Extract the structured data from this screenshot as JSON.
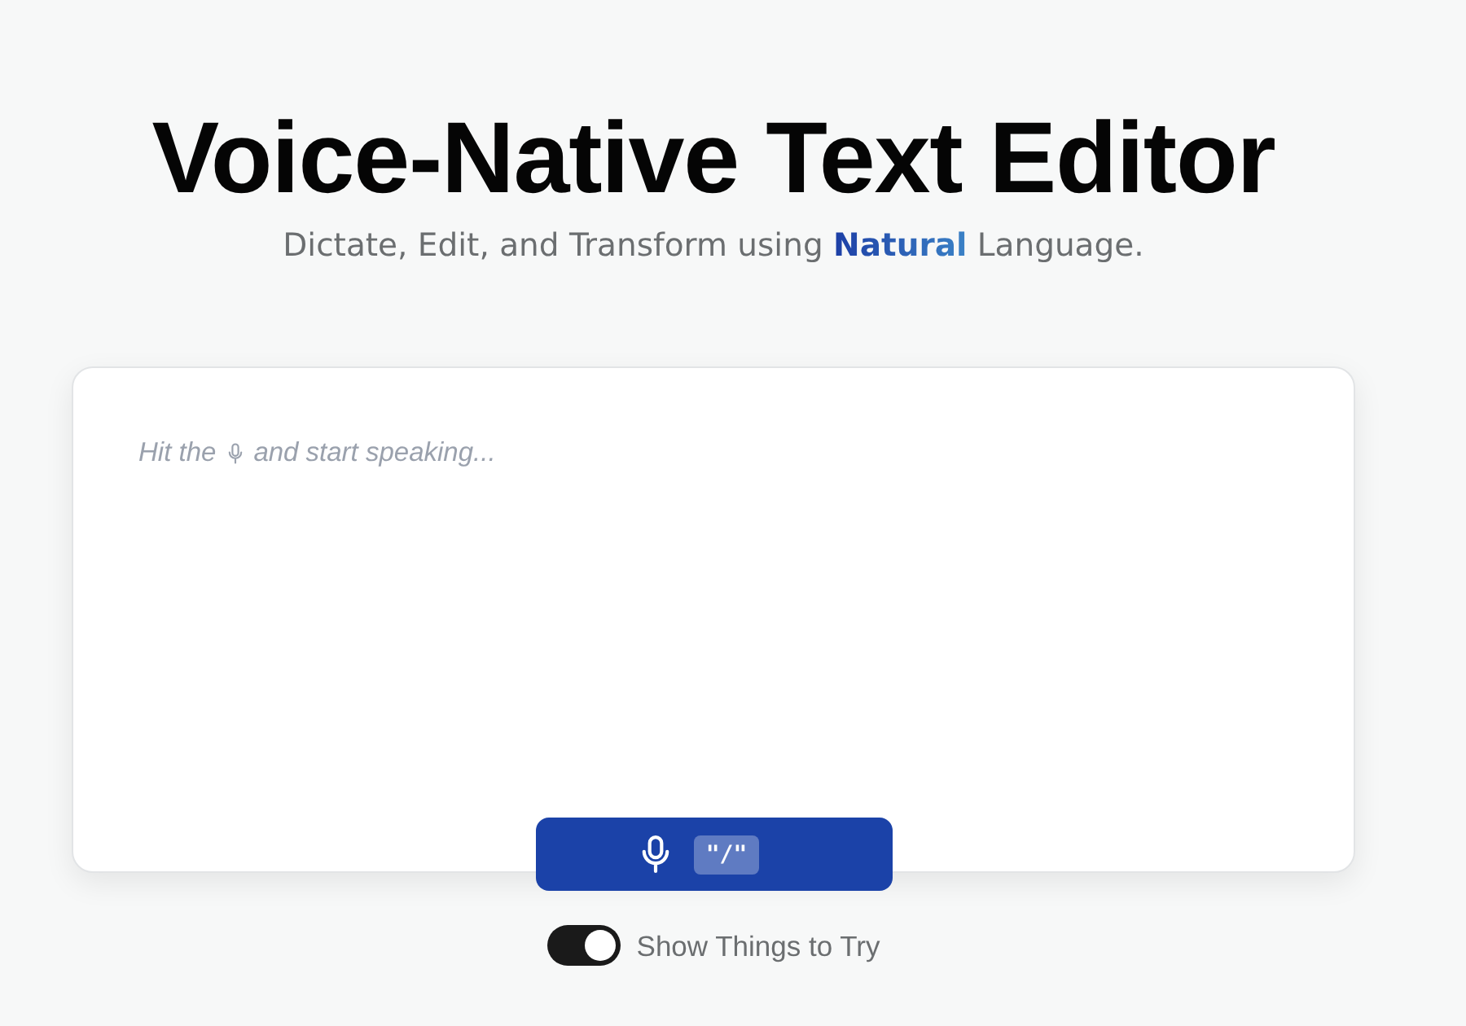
{
  "header": {
    "title": "Voice-Native Text Editor",
    "subtitle": "Dictate, Edit, and Transform using **Natural** Language."
  },
  "editor": {
    "placeholder": {
      "before_icon": "Hit the",
      "after_icon": "and start speaking..."
    }
  },
  "record_button": {
    "shortcut": "\"/\""
  },
  "toggle": {
    "label": "Show Things to Try",
    "on": true
  }
}
